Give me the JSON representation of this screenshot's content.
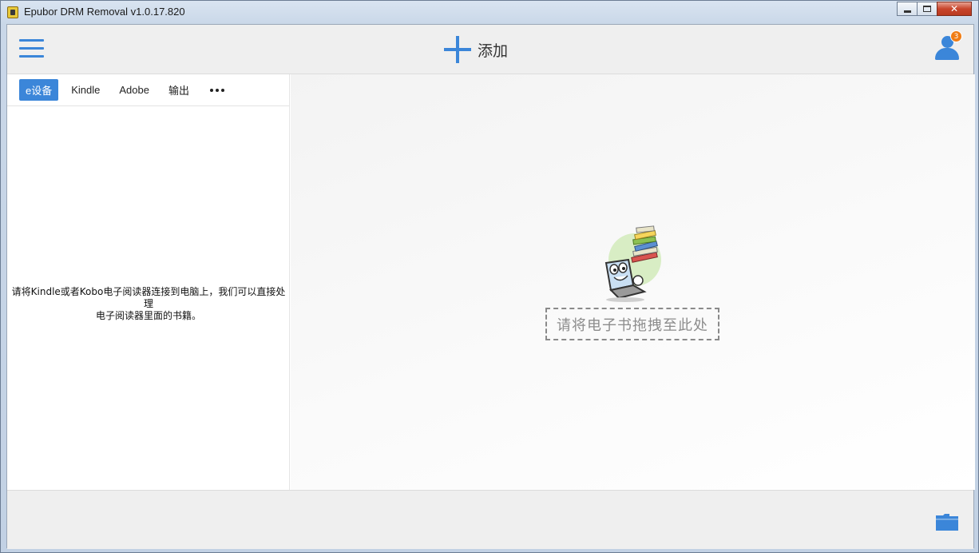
{
  "window": {
    "title": "Epubor DRM Removal v1.0.17.820"
  },
  "header": {
    "add_label": "添加",
    "notification_count": "3"
  },
  "tabs": [
    {
      "label": "e设备",
      "active": true
    },
    {
      "label": "Kindle",
      "active": false
    },
    {
      "label": "Adobe",
      "active": false
    },
    {
      "label": "输出",
      "active": false
    }
  ],
  "left_panel": {
    "hint_line1": "请将Kindle或者Kobo电子阅读器连接到电脑上，我们可以直接处理",
    "hint_line2": "电子阅读器里面的书籍。"
  },
  "drop_zone": {
    "label": "请将电子书拖拽至此处"
  },
  "colors": {
    "accent": "#3b86d9",
    "badge": "#f07d16"
  },
  "icons": [
    "app-icon",
    "minimize-icon",
    "maximize-icon",
    "close-icon",
    "hamburger-menu-icon",
    "plus-icon",
    "user-icon",
    "more-icon",
    "mascot-icon",
    "folder-icon"
  ]
}
